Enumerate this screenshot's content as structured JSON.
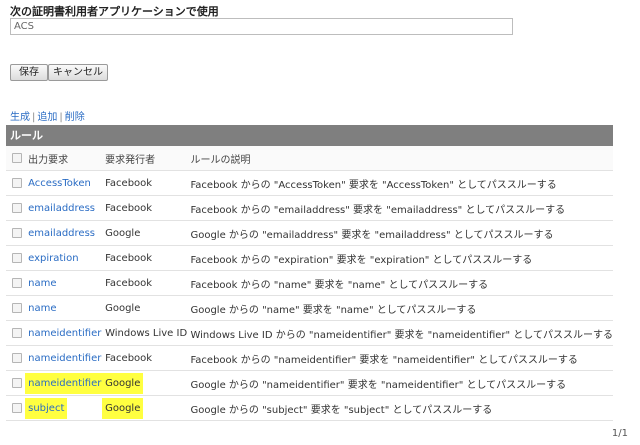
{
  "form": {
    "field_label": "次の証明書利用者アプリケーションで使用",
    "field_value": "ACS",
    "save_label": "保存",
    "cancel_label": "キャンセル"
  },
  "actions": {
    "generate": "生成",
    "separator": "|",
    "add": "追加",
    "delete": "削除"
  },
  "grid": {
    "title": "ルール",
    "columns": [
      "出力要求",
      "要求発行者",
      "ルールの説明"
    ],
    "rows": [
      {
        "claim": "AccessToken",
        "issuer": "Facebook",
        "description": "Facebook からの \"AccessToken\" 要求を \"AccessToken\" としてパススルーする",
        "highlighted": false
      },
      {
        "claim": "emailaddress",
        "issuer": "Facebook",
        "description": "Facebook からの \"emailaddress\" 要求を \"emailaddress\" としてパススルーする",
        "highlighted": false
      },
      {
        "claim": "emailaddress",
        "issuer": "Google",
        "description": "Google からの \"emailaddress\" 要求を \"emailaddress\" としてパススルーする",
        "highlighted": false
      },
      {
        "claim": "expiration",
        "issuer": "Facebook",
        "description": "Facebook からの \"expiration\" 要求を \"expiration\" としてパススルーする",
        "highlighted": false
      },
      {
        "claim": "name",
        "issuer": "Facebook",
        "description": "Facebook からの \"name\" 要求を \"name\" としてパススルーする",
        "highlighted": false
      },
      {
        "claim": "name",
        "issuer": "Google",
        "description": "Google からの \"name\" 要求を \"name\" としてパススルーする",
        "highlighted": false
      },
      {
        "claim": "nameidentifier",
        "issuer": "Windows Live ID",
        "description": "Windows Live ID からの \"nameidentifier\" 要求を \"nameidentifier\" としてパススルーする",
        "highlighted": false
      },
      {
        "claim": "nameidentifier",
        "issuer": "Facebook",
        "description": "Facebook からの \"nameidentifier\" 要求を \"nameidentifier\" としてパススルーする",
        "highlighted": false
      },
      {
        "claim": "nameidentifier",
        "issuer": "Google",
        "description": "Google からの \"nameidentifier\" 要求を \"nameidentifier\" としてパススルーする",
        "highlighted": true
      },
      {
        "claim": "subject",
        "issuer": "Google",
        "description": "Google からの \"subject\" 要求を \"subject\" としてパススルーする",
        "highlighted": true
      }
    ],
    "pager": "1/1"
  },
  "colors": {
    "link": "#2a6cc4",
    "header_bar": "#7f7f7f",
    "highlight": "#ffff40"
  }
}
